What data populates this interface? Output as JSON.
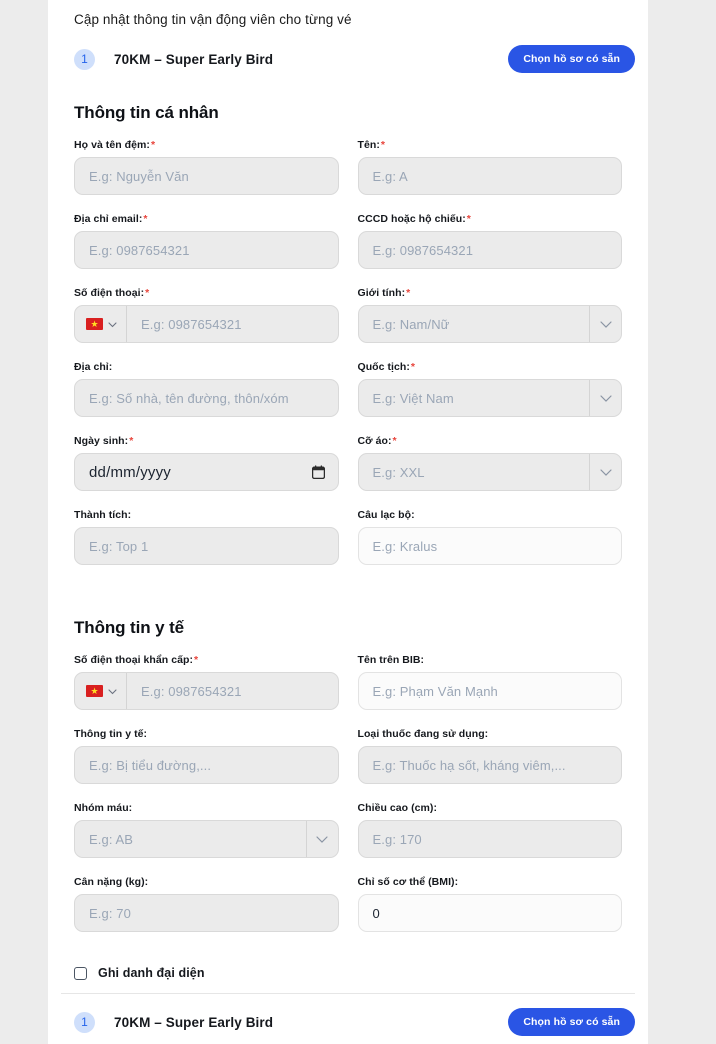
{
  "intro": "Cập nhật thông tin vận động viên cho từng vé",
  "ticket": {
    "number": "1",
    "name": "70KM – Super Early Bird",
    "choose_profile_label": "Chọn hồ sơ có sẵn"
  },
  "sections": {
    "personal_title": "Thông tin cá nhân",
    "medical_title": "Thông tin y tế"
  },
  "personal": {
    "last_name": {
      "label": "Họ và tên đệm:",
      "required": "*",
      "placeholder": "E.g: Nguyễn Văn",
      "value": ""
    },
    "first_name": {
      "label": "Tên:",
      "required": "*",
      "placeholder": "E.g: A",
      "value": ""
    },
    "email": {
      "label": "Địa chỉ email:",
      "required": "*",
      "placeholder": "E.g: 0987654321",
      "value": ""
    },
    "id_number": {
      "label": "CCCD hoặc hộ chiếu:",
      "required": "*",
      "placeholder": "E.g: 0987654321",
      "value": ""
    },
    "phone": {
      "label": "Số điện thoại:",
      "required": "*",
      "placeholder": "E.g: 0987654321",
      "value": "",
      "country_flag": "vietnam-flag"
    },
    "gender": {
      "label": "Giới tính:",
      "required": "*",
      "placeholder": "E.g: Nam/Nữ",
      "value": ""
    },
    "address": {
      "label": "Địa chỉ:",
      "required": "",
      "placeholder": "E.g: Số nhà, tên đường, thôn/xóm",
      "value": ""
    },
    "nationality": {
      "label": "Quốc tịch:",
      "required": "*",
      "placeholder": "E.g: Việt Nam",
      "value": ""
    },
    "birthday": {
      "label": "Ngày sinh:",
      "required": "*",
      "placeholder": "dd/mm/yyyy",
      "value": "dd/mm/yyyy"
    },
    "shirt_size": {
      "label": "Cỡ áo:",
      "required": "*",
      "placeholder": "E.g: XXL",
      "value": ""
    },
    "achievement": {
      "label": "Thành tích:",
      "required": "",
      "placeholder": "E.g: Top 1",
      "value": ""
    },
    "club": {
      "label": "Câu lạc bộ:",
      "required": "",
      "placeholder": "E.g: Kralus",
      "value": ""
    }
  },
  "medical": {
    "emergency_phone": {
      "label": "Số điện thoại khẩn cấp:",
      "required": "*",
      "placeholder": "E.g: 0987654321",
      "value": "",
      "country_flag": "vietnam-flag"
    },
    "bib_name": {
      "label": "Tên trên BIB:",
      "required": "",
      "placeholder": "E.g: Phạm Văn Mạnh",
      "value": ""
    },
    "medical_info": {
      "label": "Thông tin y tế:",
      "required": "",
      "placeholder": "E.g: Bị tiểu đường,...",
      "value": ""
    },
    "medications": {
      "label": "Loại thuốc đang sử dụng:",
      "required": "",
      "placeholder": "E.g: Thuốc hạ sốt, kháng viêm,...",
      "value": ""
    },
    "blood_type": {
      "label": "Nhóm máu:",
      "required": "",
      "placeholder": "E.g: AB",
      "value": ""
    },
    "height": {
      "label": "Chiều cao (cm):",
      "required": "",
      "placeholder": "E.g: 170",
      "value": ""
    },
    "weight": {
      "label": "Cân nặng (kg):",
      "required": "",
      "placeholder": "E.g: 70",
      "value": ""
    },
    "bmi": {
      "label": "Chỉ số cơ thể (BMI):",
      "required": "",
      "placeholder": "",
      "value": "0"
    }
  },
  "representative_checkbox": {
    "label": "Ghi danh đại diện",
    "checked": false
  },
  "colors": {
    "accent_blue": "#2a55e5",
    "badge_blue_bg": "#cfdffb",
    "badge_blue_text": "#2563eb",
    "required_red": "#e8453c",
    "input_bg": "#ebebeb",
    "page_bg": "#ececec"
  }
}
